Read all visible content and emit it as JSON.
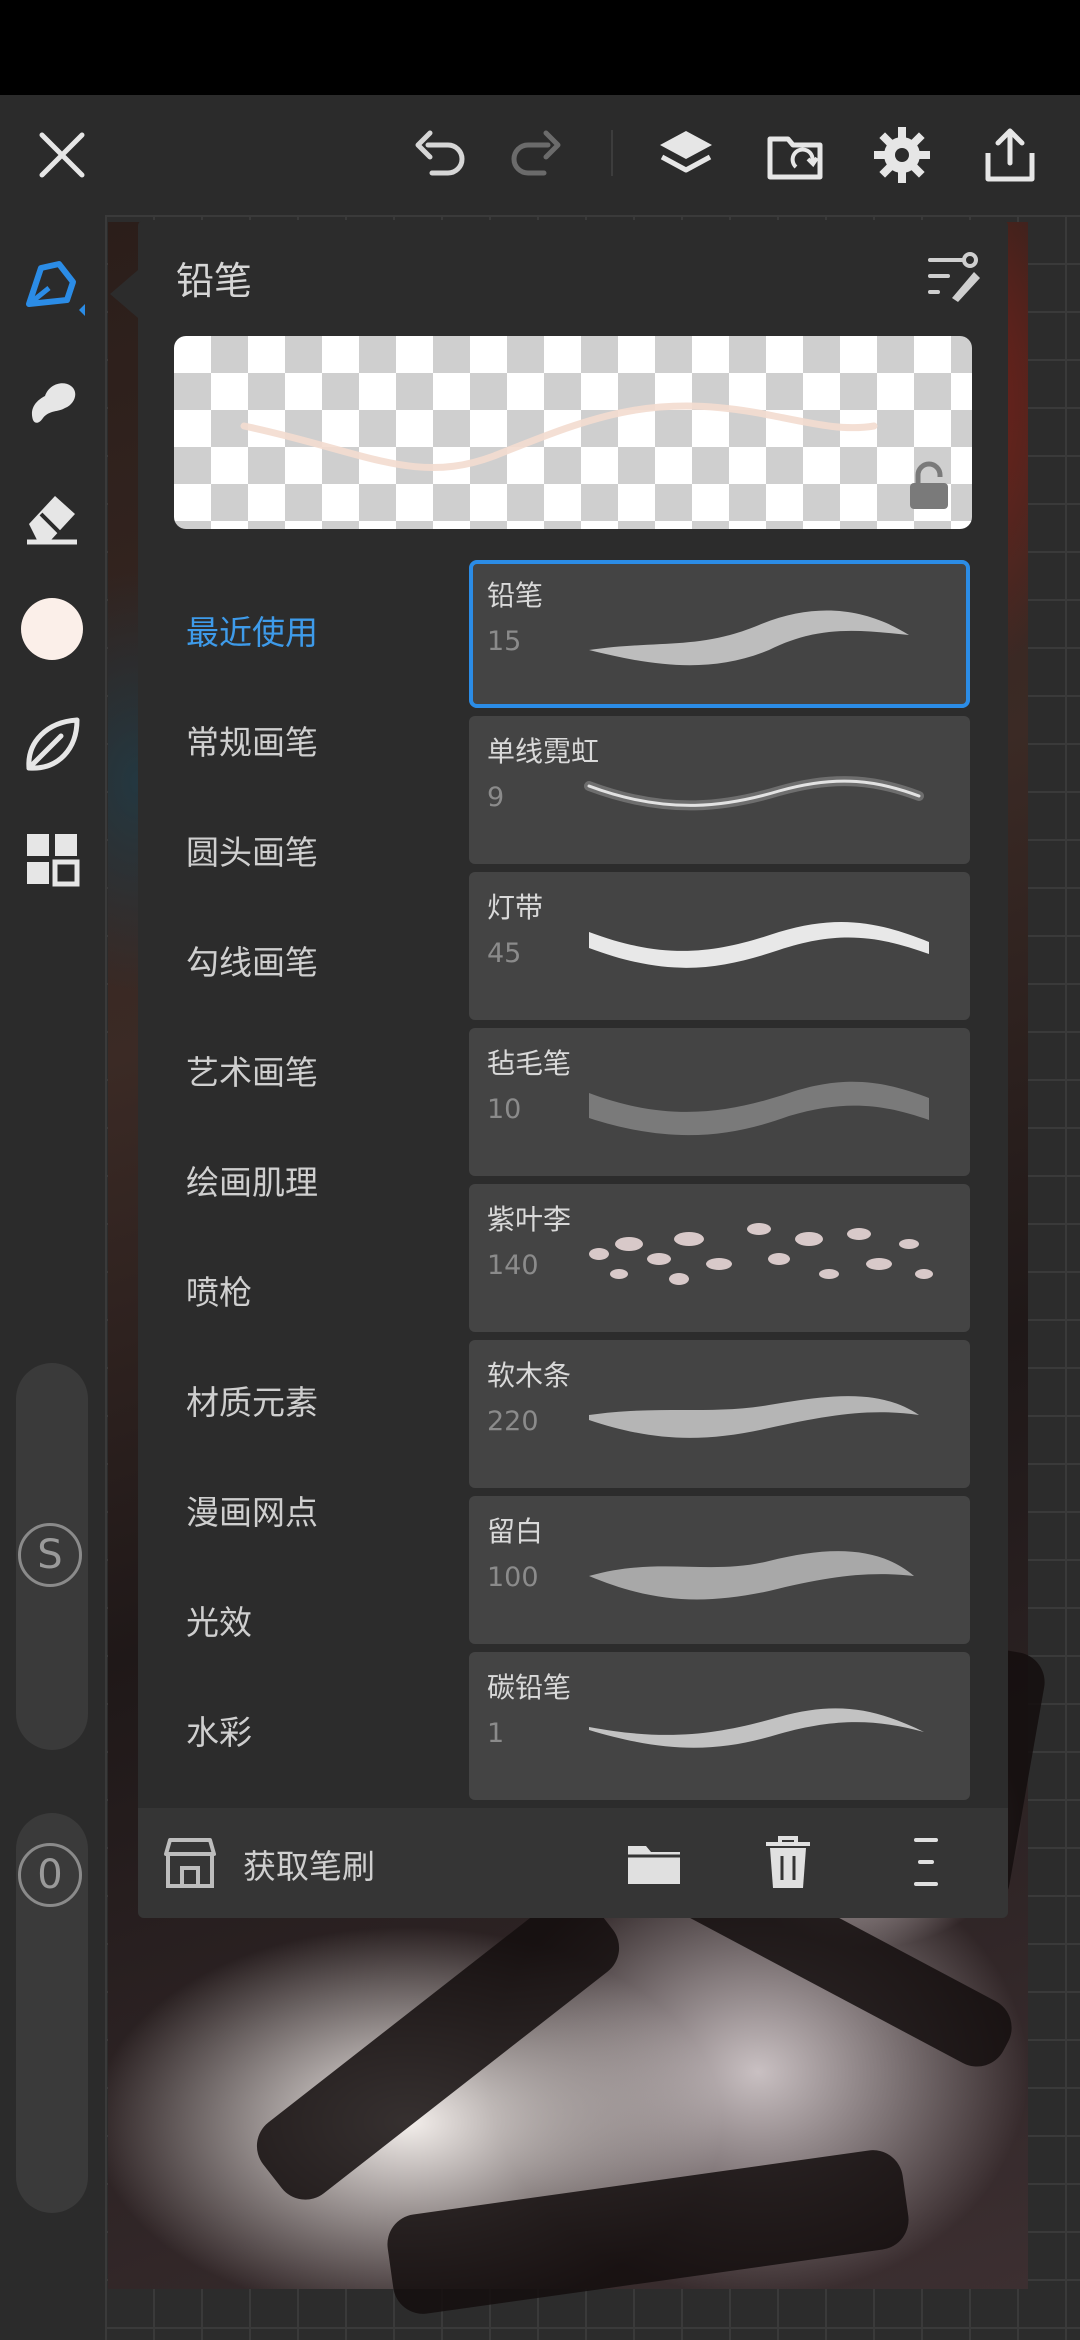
{
  "panel": {
    "title": "铅笔",
    "get_brushes_label": "获取笔刷"
  },
  "categories": [
    {
      "label": "最近使用",
      "active": true
    },
    {
      "label": "常规画笔"
    },
    {
      "label": "圆头画笔"
    },
    {
      "label": "勾线画笔"
    },
    {
      "label": "艺术画笔"
    },
    {
      "label": "绘画肌理"
    },
    {
      "label": "喷枪"
    },
    {
      "label": "材质元素"
    },
    {
      "label": "漫画网点"
    },
    {
      "label": "光效"
    },
    {
      "label": "水彩"
    }
  ],
  "brushes": [
    {
      "name": "铅笔",
      "size": "15",
      "selected": true
    },
    {
      "name": "单线霓虹",
      "size": "9"
    },
    {
      "name": "灯带",
      "size": "45"
    },
    {
      "name": "毡毛笔",
      "size": "10"
    },
    {
      "name": "紫叶李",
      "size": "140"
    },
    {
      "name": "软木条",
      "size": "220"
    },
    {
      "name": "留白",
      "size": "100"
    },
    {
      "name": "碳铅笔",
      "size": "1"
    }
  ],
  "sliders": {
    "size_knob": "S",
    "opacity_knob": "0"
  },
  "colors": {
    "accent": "#2b8ce6",
    "current_color": "#fbefe9",
    "panel_bg": "#2c2c2c",
    "card_bg": "#444444"
  }
}
